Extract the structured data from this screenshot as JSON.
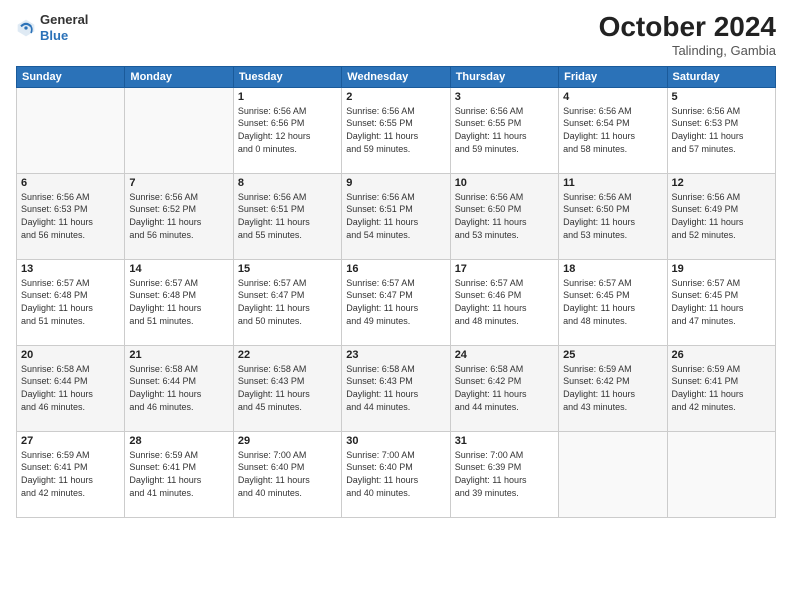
{
  "header": {
    "logo_line1": "General",
    "logo_line2": "Blue",
    "month": "October 2024",
    "location": "Talinding, Gambia"
  },
  "weekdays": [
    "Sunday",
    "Monday",
    "Tuesday",
    "Wednesday",
    "Thursday",
    "Friday",
    "Saturday"
  ],
  "weeks": [
    [
      {
        "day": "",
        "info": ""
      },
      {
        "day": "",
        "info": ""
      },
      {
        "day": "1",
        "info": "Sunrise: 6:56 AM\nSunset: 6:56 PM\nDaylight: 12 hours\nand 0 minutes."
      },
      {
        "day": "2",
        "info": "Sunrise: 6:56 AM\nSunset: 6:55 PM\nDaylight: 11 hours\nand 59 minutes."
      },
      {
        "day": "3",
        "info": "Sunrise: 6:56 AM\nSunset: 6:55 PM\nDaylight: 11 hours\nand 59 minutes."
      },
      {
        "day": "4",
        "info": "Sunrise: 6:56 AM\nSunset: 6:54 PM\nDaylight: 11 hours\nand 58 minutes."
      },
      {
        "day": "5",
        "info": "Sunrise: 6:56 AM\nSunset: 6:53 PM\nDaylight: 11 hours\nand 57 minutes."
      }
    ],
    [
      {
        "day": "6",
        "info": "Sunrise: 6:56 AM\nSunset: 6:53 PM\nDaylight: 11 hours\nand 56 minutes."
      },
      {
        "day": "7",
        "info": "Sunrise: 6:56 AM\nSunset: 6:52 PM\nDaylight: 11 hours\nand 56 minutes."
      },
      {
        "day": "8",
        "info": "Sunrise: 6:56 AM\nSunset: 6:51 PM\nDaylight: 11 hours\nand 55 minutes."
      },
      {
        "day": "9",
        "info": "Sunrise: 6:56 AM\nSunset: 6:51 PM\nDaylight: 11 hours\nand 54 minutes."
      },
      {
        "day": "10",
        "info": "Sunrise: 6:56 AM\nSunset: 6:50 PM\nDaylight: 11 hours\nand 53 minutes."
      },
      {
        "day": "11",
        "info": "Sunrise: 6:56 AM\nSunset: 6:50 PM\nDaylight: 11 hours\nand 53 minutes."
      },
      {
        "day": "12",
        "info": "Sunrise: 6:56 AM\nSunset: 6:49 PM\nDaylight: 11 hours\nand 52 minutes."
      }
    ],
    [
      {
        "day": "13",
        "info": "Sunrise: 6:57 AM\nSunset: 6:48 PM\nDaylight: 11 hours\nand 51 minutes."
      },
      {
        "day": "14",
        "info": "Sunrise: 6:57 AM\nSunset: 6:48 PM\nDaylight: 11 hours\nand 51 minutes."
      },
      {
        "day": "15",
        "info": "Sunrise: 6:57 AM\nSunset: 6:47 PM\nDaylight: 11 hours\nand 50 minutes."
      },
      {
        "day": "16",
        "info": "Sunrise: 6:57 AM\nSunset: 6:47 PM\nDaylight: 11 hours\nand 49 minutes."
      },
      {
        "day": "17",
        "info": "Sunrise: 6:57 AM\nSunset: 6:46 PM\nDaylight: 11 hours\nand 48 minutes."
      },
      {
        "day": "18",
        "info": "Sunrise: 6:57 AM\nSunset: 6:45 PM\nDaylight: 11 hours\nand 48 minutes."
      },
      {
        "day": "19",
        "info": "Sunrise: 6:57 AM\nSunset: 6:45 PM\nDaylight: 11 hours\nand 47 minutes."
      }
    ],
    [
      {
        "day": "20",
        "info": "Sunrise: 6:58 AM\nSunset: 6:44 PM\nDaylight: 11 hours\nand 46 minutes."
      },
      {
        "day": "21",
        "info": "Sunrise: 6:58 AM\nSunset: 6:44 PM\nDaylight: 11 hours\nand 46 minutes."
      },
      {
        "day": "22",
        "info": "Sunrise: 6:58 AM\nSunset: 6:43 PM\nDaylight: 11 hours\nand 45 minutes."
      },
      {
        "day": "23",
        "info": "Sunrise: 6:58 AM\nSunset: 6:43 PM\nDaylight: 11 hours\nand 44 minutes."
      },
      {
        "day": "24",
        "info": "Sunrise: 6:58 AM\nSunset: 6:42 PM\nDaylight: 11 hours\nand 44 minutes."
      },
      {
        "day": "25",
        "info": "Sunrise: 6:59 AM\nSunset: 6:42 PM\nDaylight: 11 hours\nand 43 minutes."
      },
      {
        "day": "26",
        "info": "Sunrise: 6:59 AM\nSunset: 6:41 PM\nDaylight: 11 hours\nand 42 minutes."
      }
    ],
    [
      {
        "day": "27",
        "info": "Sunrise: 6:59 AM\nSunset: 6:41 PM\nDaylight: 11 hours\nand 42 minutes."
      },
      {
        "day": "28",
        "info": "Sunrise: 6:59 AM\nSunset: 6:41 PM\nDaylight: 11 hours\nand 41 minutes."
      },
      {
        "day": "29",
        "info": "Sunrise: 7:00 AM\nSunset: 6:40 PM\nDaylight: 11 hours\nand 40 minutes."
      },
      {
        "day": "30",
        "info": "Sunrise: 7:00 AM\nSunset: 6:40 PM\nDaylight: 11 hours\nand 40 minutes."
      },
      {
        "day": "31",
        "info": "Sunrise: 7:00 AM\nSunset: 6:39 PM\nDaylight: 11 hours\nand 39 minutes."
      },
      {
        "day": "",
        "info": ""
      },
      {
        "day": "",
        "info": ""
      }
    ]
  ]
}
